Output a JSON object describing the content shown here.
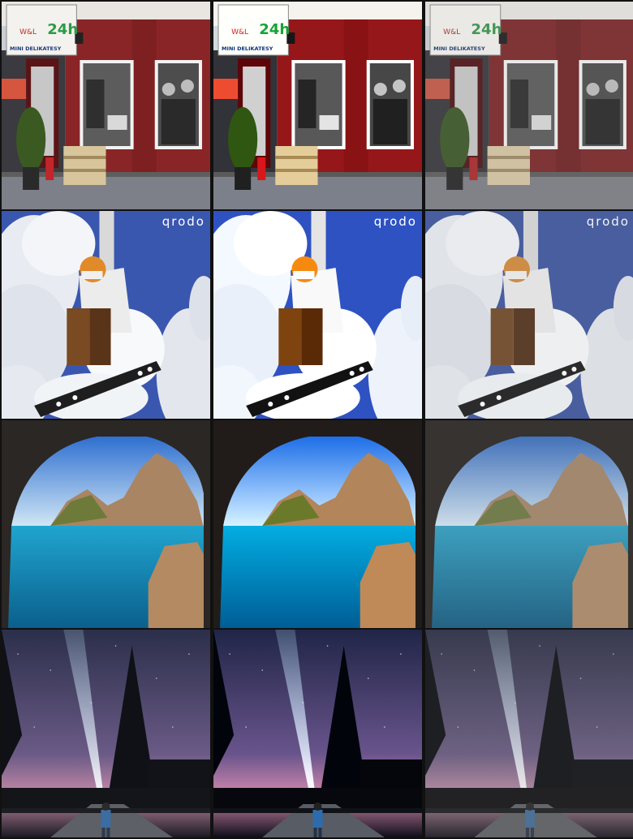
{
  "grid": {
    "rows": 4,
    "columns": 3
  },
  "rows": [
    {
      "scene": "storefront",
      "sign_top": "W&L",
      "sign_hours": "24h",
      "sign_name": "MINI DELIKATESY"
    },
    {
      "scene": "snowboarder",
      "watermark": "qrodo"
    },
    {
      "scene": "sea-cave"
    },
    {
      "scene": "night-flashlight"
    }
  ],
  "columns": [
    "variant-1",
    "variant-2",
    "variant-3"
  ]
}
